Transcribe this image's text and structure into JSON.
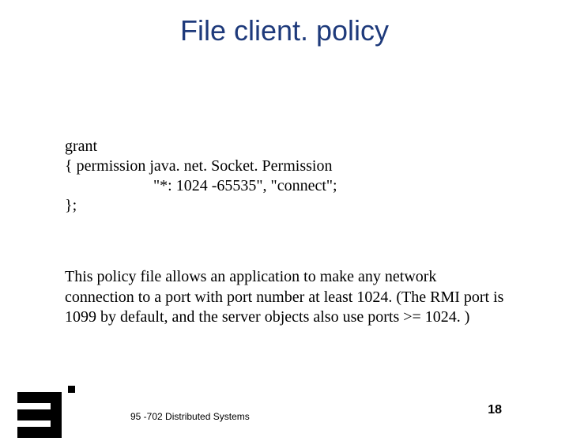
{
  "title": "File client. policy",
  "code": {
    "line1": "grant",
    "line2": "{    permission java. net. Socket. Permission",
    "line3": "\"*: 1024 -65535\", \"connect\";",
    "line4": "};"
  },
  "description": "This policy file allows an application to make any network connection to a port with port number at least 1024. (The RMI port is 1099 by default, and the server objects also use ports >= 1024. )",
  "footer": {
    "course": "95 -702 Distributed Systems",
    "page": "18"
  }
}
